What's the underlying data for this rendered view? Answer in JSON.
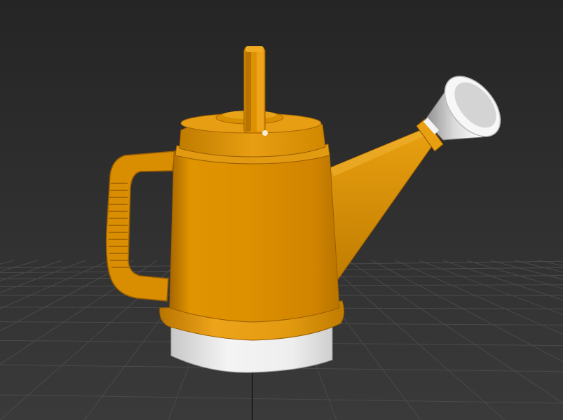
{
  "viewport": {
    "background_top": "#252525",
    "background_bottom": "#3a3a3a",
    "grid_color": "#4a4a4a",
    "grid_center_color": "#1e1e1e"
  },
  "model": {
    "object": "watering-can",
    "body_color": "#dd9000",
    "body_shadow": "#a86600",
    "body_highlight": "#f0aa1a",
    "base_color": "#e8e8e8",
    "base_shadow": "#bdbdbd",
    "rose_color": "#f2f2f2",
    "rose_shadow": "#9a9a9a"
  }
}
